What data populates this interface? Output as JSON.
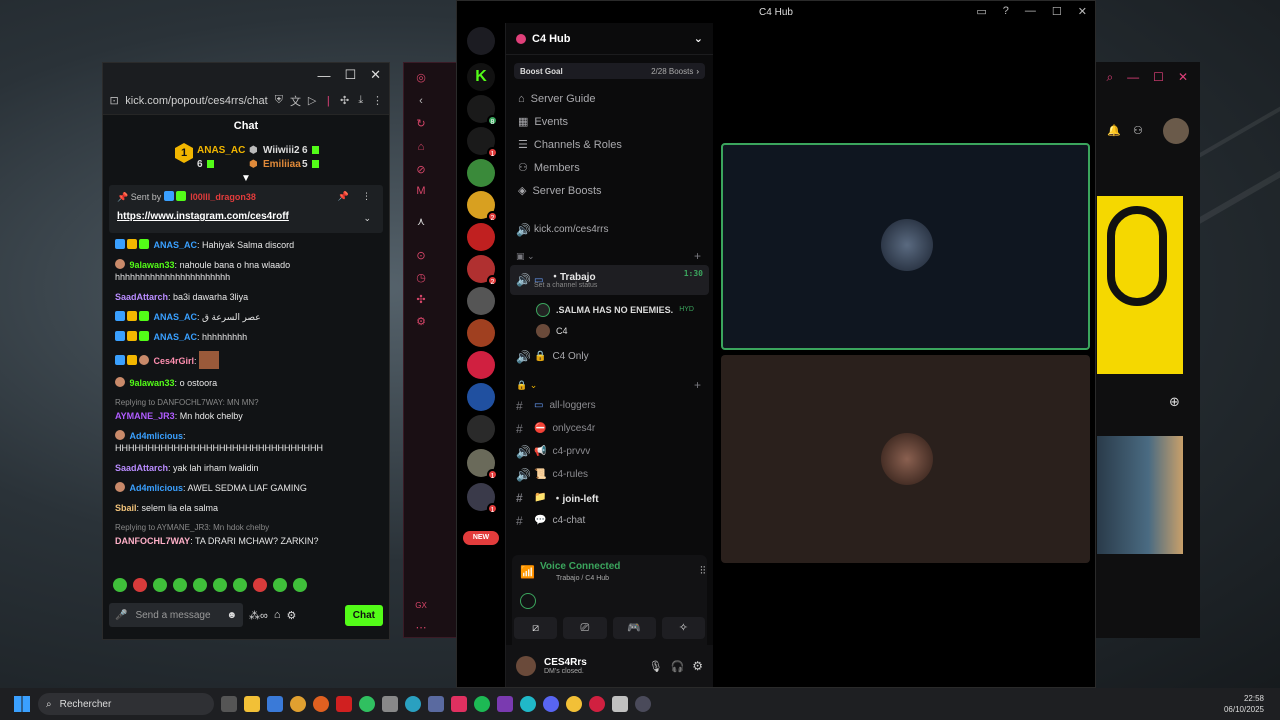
{
  "kick": {
    "url": "kick.com/popout/ces4rrs/chat",
    "chat_title": "Chat",
    "leader_rank": "1",
    "leader1_name": "ANAS_AC",
    "leader1_count": "6",
    "leader2_name": "Wiiwiii2",
    "leader2_count": "6",
    "leader3_name": "Emiliiaa",
    "leader3_count": "5",
    "pinned_sentby": "Sent by",
    "pinned_user": "l00lll_dragon38",
    "pinned_link": "https://www.instagram.com/ces4roff",
    "messages": [
      {
        "user": "ANAS_AC",
        "text": "Hahiyak Salma discord"
      },
      {
        "user": "9alawan33",
        "text": "nahoule bana o hna wlaado hhhhhhhhhhhhhhhhhhhhhhh"
      },
      {
        "user": "SaadAttarch",
        "text": "ba3i dawarha 3liya"
      },
      {
        "user": "ANAS_AC",
        "text": "عصر السرعة ق"
      },
      {
        "user": "ANAS_AC",
        "text": "hhhhhhhhh"
      },
      {
        "user": "Ces4rGirl",
        "text": ""
      },
      {
        "user": "9alawan33",
        "text": "o ostoora"
      },
      {
        "reply": "Replying to DANFOCHL7WAY: MN MN?",
        "user": "AYMANE_JR3",
        "text": "Mn hdok chelby"
      },
      {
        "user": "Ad4mlicious",
        "text": "HHHHHHHHHHHHHHHHHHHHHHHHHHHHHHHH"
      },
      {
        "user": "SaadAttarch",
        "text": "yak lah irham lwalidin"
      },
      {
        "user": "Ad4mlicious",
        "text": "AWEL SEDMA LIAF GAMING"
      },
      {
        "user": "Sbail",
        "text": "selem lia ela salma"
      },
      {
        "reply": "Replying to AYMANE_JR3: Mn hdok chelby",
        "user": "DANFOCHL7WAY",
        "text": "TA DRARI MCHAW? ZARKIN?"
      }
    ],
    "input_placeholder": "Send a message",
    "chat_button": "Chat",
    "colors": {
      "accent": "#53fc18"
    }
  },
  "discord": {
    "window_title": "C4 Hub",
    "server_name": "C4 Hub",
    "boost_label": "Boost Goal",
    "boost_count": "2/28 Boosts",
    "nav": [
      "Server Guide",
      "Events",
      "Channels & Roles",
      "Members",
      "Server Boosts"
    ],
    "link_channel": "kick.com/ces4rrs",
    "voice_channel": "・Trabajo",
    "voice_timer": "1:30",
    "voice_status": "Set a channel status",
    "voice_user1": ".SALMA HAS NO ENEMIES.",
    "voice_user1_tag": "HYD",
    "voice_user2": "C4",
    "c4only": "C4 Only",
    "channels": [
      "all-loggers",
      "onlyces4r",
      "c4-prvvv",
      "c4-rules",
      "・join-left",
      "c4-chat"
    ],
    "voice_connected": "Voice Connected",
    "voice_location": "Trabajo / C4 Hub",
    "username": "CES4Rrs",
    "user_status": "DM's closed.",
    "new_badge": "NEW",
    "badges": [
      "8",
      "1",
      "2",
      "2",
      "1",
      "1"
    ]
  },
  "taskbar": {
    "search": "Rechercher",
    "time": "22:58",
    "date": "06/10/2025"
  }
}
